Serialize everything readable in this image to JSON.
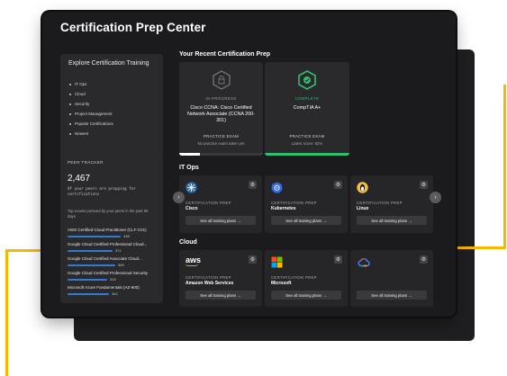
{
  "app": {
    "title": "Certification Prep Center"
  },
  "explore": {
    "title": "Explore Certification Training",
    "items": [
      "IT Ops",
      "Cloud",
      "Security",
      "Project Management",
      "Popular Certifications",
      "Newest"
    ]
  },
  "peer_tracker": {
    "label": "PEER TRACKER",
    "count": "2,467",
    "description": "Of your peers are prepping for certifications",
    "subtitle": "Top exams pursued by your peers in the past 90 days",
    "exams": [
      {
        "name": "AWS Certified Cloud Practitioner (CLF-C01)",
        "count": "438",
        "share": 0.74
      },
      {
        "name": "Google Cloud Certified Professional Cloud...",
        "count": "371",
        "share": 0.63
      },
      {
        "name": "Google Cloud Certified Associate Cloud...",
        "count": "389",
        "share": 0.66
      },
      {
        "name": "Google Cloud Certified Professional Security",
        "count": "315",
        "share": 0.55
      },
      {
        "name": "Microsoft Azure Fundamentals (AZ-900)",
        "count": "342",
        "share": 0.58
      }
    ]
  },
  "recent": {
    "title": "Your Recent Certification Prep",
    "cards": [
      {
        "status": "IN PROGRESS",
        "name": "Cisco CCNA: Cisco Certified Network Associate (CCNA 200-301)",
        "mode": "PRACTICE EXAM",
        "note": "No practice exam taken yet",
        "progress": 0.25,
        "accent": "#ffffff",
        "status_color": "#9c9da1",
        "icon": "lock-hex-icon"
      },
      {
        "status": "COMPLETE",
        "name": "CompTIA A+",
        "mode": "PRACTICE EXAM",
        "note": "Latest score: 92%",
        "progress": 1.0,
        "accent": "#2fbf71",
        "status_color": "#2fbf71",
        "icon": "check-hex-icon"
      }
    ]
  },
  "itops": {
    "title": "IT Ops",
    "cards": [
      {
        "kind": "CERTIFICATION PREP",
        "vendor": "Cisco",
        "button": "See all training plans →",
        "logo": "cisco-logo-icon"
      },
      {
        "kind": "CERTIFICATION PREP",
        "vendor": "Kubernetes",
        "button": "See all training plans →",
        "logo": "kubernetes-logo-icon"
      },
      {
        "kind": "CERTIFICATION PREP",
        "vendor": "Linux",
        "button": "See all training plans →",
        "logo": "linux-logo-icon"
      }
    ]
  },
  "cloud": {
    "title": "Cloud",
    "cards": [
      {
        "kind": "CERTIFICATION PREP",
        "vendor": "Amazon Web Services",
        "button": "See all training plans →",
        "logo": "aws-logo-icon",
        "logo_text": "aws"
      },
      {
        "kind": "CERTIFICATION PREP",
        "vendor": "Microsoft",
        "button": "See all training plans →",
        "logo": "microsoft-logo-icon"
      },
      {
        "kind": "",
        "vendor": "",
        "button": "See all training plans →",
        "logo": "google-cloud-logo-icon"
      }
    ]
  },
  "nav": {
    "prev": "‹",
    "next": "›"
  },
  "colors": {
    "accent_yellow": "#f5b800",
    "bar_blue": "#2f7bd6",
    "complete_green": "#2fbf71"
  }
}
